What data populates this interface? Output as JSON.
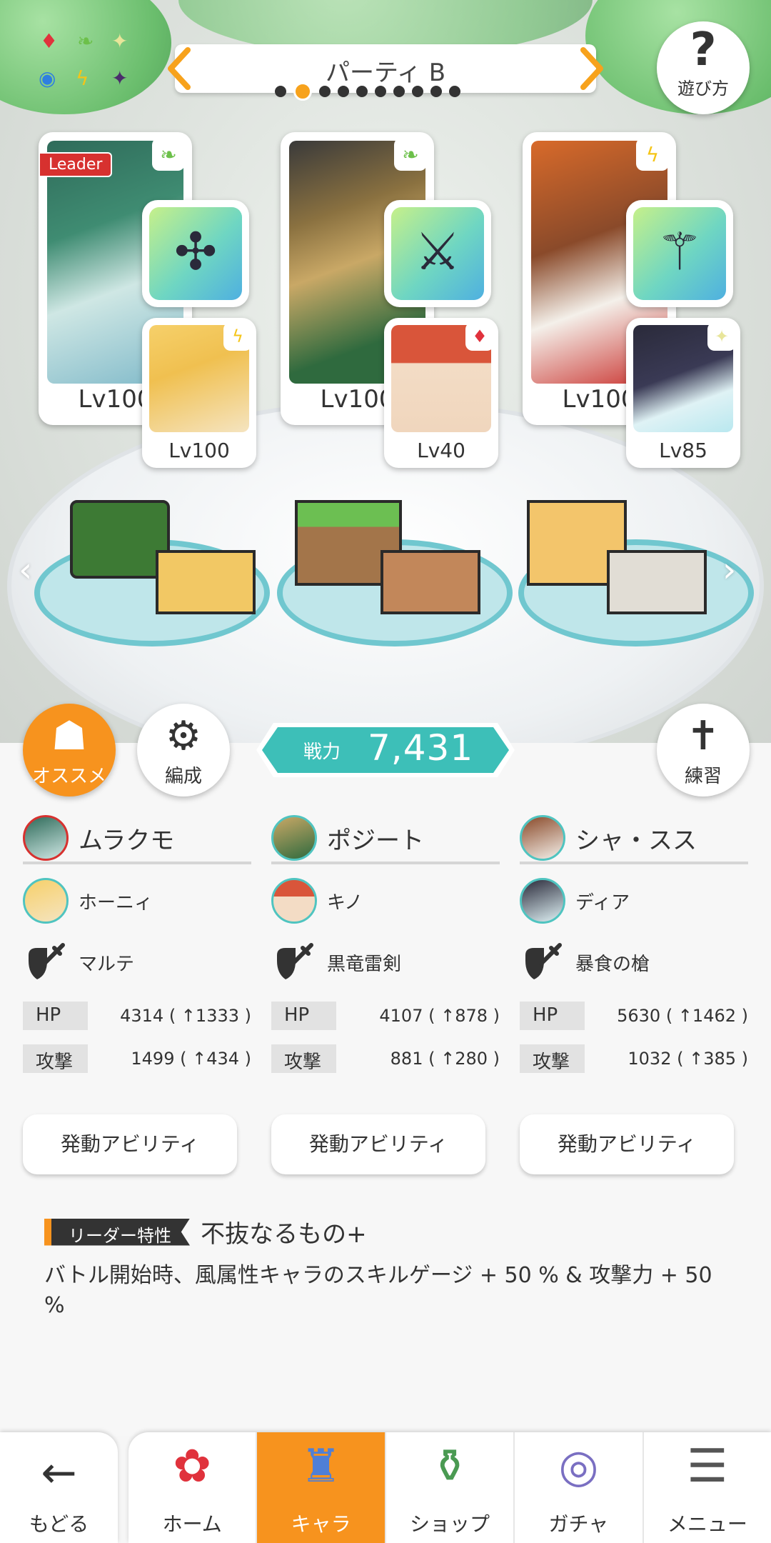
{
  "header": {
    "party_name": "パーティ B",
    "page_count": 10,
    "active_page": 2,
    "help_label": "遊び方",
    "element_icons": [
      "fire-diamond",
      "wind-leaf",
      "light-sparkle",
      "water-circle",
      "thunder-bolt",
      "dark-star"
    ]
  },
  "units": [
    {
      "main_name": "ムラクモ",
      "main_level": "Lv100",
      "main_element": "wind",
      "is_leader": true,
      "leader_label": "Leader",
      "support_name": "ホーニィ",
      "support_level": "Lv100",
      "support_element": "thunder",
      "weapon_name": "マルテ",
      "hp_label": "HP",
      "hp_value": "4314 ( ↑1333 )",
      "atk_label": "攻撃",
      "atk_value": "1499 ( ↑434 )",
      "ability_label": "発動アビリティ"
    },
    {
      "main_name": "ポジート",
      "main_level": "Lv100",
      "main_element": "wind",
      "is_leader": false,
      "support_name": "キノ",
      "support_level": "Lv40",
      "support_element": "fire",
      "weapon_name": "黒竜雷剣",
      "hp_label": "HP",
      "hp_value": "4107 ( ↑878 )",
      "atk_label": "攻撃",
      "atk_value": "881 ( ↑280 )",
      "ability_label": "発動アビリティ"
    },
    {
      "main_name": "シャ・スス",
      "main_level": "Lv100",
      "main_element": "thunder",
      "is_leader": false,
      "support_name": "ディア",
      "support_level": "Lv85",
      "support_element": "light",
      "weapon_name": "暴食の槍",
      "hp_label": "HP",
      "hp_value": "5630 ( ↑1462 )",
      "atk_label": "攻撃",
      "atk_value": "1032 ( ↑385 )",
      "ability_label": "発動アビリティ"
    }
  ],
  "actions": {
    "recommend_label": "オススメ",
    "formation_label": "編成",
    "practice_label": "練習"
  },
  "power": {
    "label": "戦力",
    "value": "7,431"
  },
  "leader_trait": {
    "tag": "リーダー特性",
    "name": "不抜なるもの+",
    "description": "バトル開始時、風属性キャラのスキルゲージ + 50 % & 攻撃力 + 50 %"
  },
  "nav": {
    "back_label": "もどる",
    "tabs": [
      {
        "label": "ホーム",
        "icon": "home-icon"
      },
      {
        "label": "キャラ",
        "icon": "character-icon",
        "active": true
      },
      {
        "label": "ショップ",
        "icon": "shop-icon"
      },
      {
        "label": "ガチャ",
        "icon": "gacha-icon"
      },
      {
        "label": "メニュー",
        "icon": "menu-icon"
      }
    ]
  },
  "colors": {
    "accent_orange": "#f7931e",
    "power_teal": "#3dbfb8",
    "leader_red": "#d7312f",
    "wind_green": "#6cc04a",
    "thunder_yellow": "#f5c518"
  }
}
